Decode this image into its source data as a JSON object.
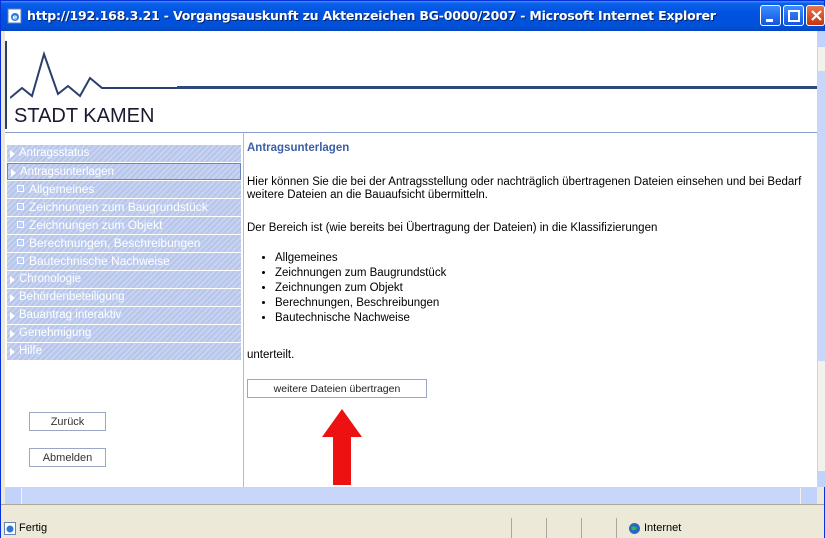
{
  "window": {
    "title": "http://192.168.3.21 - Vorgangsauskunft zu Aktenzeichen BG-0000/2007 - Microsoft Internet Explorer",
    "controls": [
      "minimize-icon",
      "maximize-icon",
      "close-icon"
    ]
  },
  "banner": {
    "name": "STADT KAMEN"
  },
  "sidebar": {
    "items": [
      {
        "label": "Antragsstatus",
        "kind": "top"
      },
      {
        "label": "Antragsunterlagen",
        "kind": "top",
        "active": true
      },
      {
        "label": "Allgemeines",
        "kind": "sub"
      },
      {
        "label": "Zeichnungen zum Baugrundstück",
        "kind": "sub"
      },
      {
        "label": "Zeichnungen zum Objekt",
        "kind": "sub"
      },
      {
        "label": "Berechnungen, Beschreibungen",
        "kind": "sub"
      },
      {
        "label": "Bautechnische Nachweise",
        "kind": "sub"
      },
      {
        "label": "Chronologie",
        "kind": "top"
      },
      {
        "label": "Behördenbeteiligung",
        "kind": "top"
      },
      {
        "label": "Bauantrag interaktiv",
        "kind": "top"
      },
      {
        "label": "Genehmigung",
        "kind": "top"
      },
      {
        "label": "Hilfe",
        "kind": "top"
      }
    ],
    "back_label": "Zurück",
    "logout_label": "Abmelden"
  },
  "content": {
    "heading": "Antragsunterlagen",
    "paragraph1": "Hier können Sie die bei der Antragsstellung oder nachträglich übertragenen Dateien einsehen und bei Bedarf weitere Dateien an die Bauaufsicht übermitteln.",
    "paragraph2": "Der Bereich ist (wie bereits bei Übertragung der Dateien) in die Klassifizierungen",
    "list": [
      "Allgemeines",
      "Zeichnungen zum Baugrundstück",
      "Zeichnungen zum Objekt",
      "Berechnungen, Beschreibungen",
      "Bautechnische Nachweise"
    ],
    "paragraph3": "unterteilt.",
    "upload_button": "weitere Dateien übertragen",
    "annotation_color": "#ee1111"
  },
  "statusbar": {
    "text": "Fertig",
    "zone": "Internet"
  }
}
